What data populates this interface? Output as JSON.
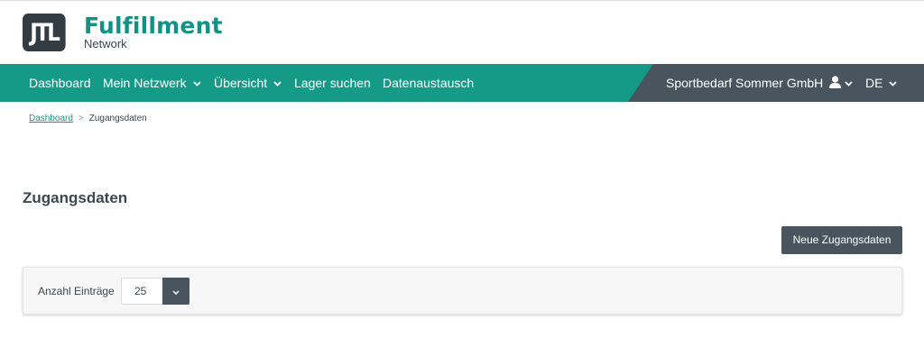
{
  "logo": {
    "mark": "JTL",
    "title": "Fulfillment",
    "subtitle": "Network"
  },
  "nav": {
    "items": [
      {
        "label": "Dashboard"
      },
      {
        "label": "Mein Netzwerk"
      },
      {
        "label": "Übersicht"
      },
      {
        "label": "Lager suchen"
      },
      {
        "label": "Datenaustausch"
      }
    ],
    "company": "Sportbedarf Sommer GmbH",
    "language": "DE"
  },
  "breadcrumb": {
    "home": "Dashboard",
    "separator": ">",
    "current": "Zugangsdaten"
  },
  "page": {
    "title": "Zugangsdaten",
    "new_button": "Neue Zugangsdaten"
  },
  "entries": {
    "label": "Anzahl Einträge",
    "value": "25"
  },
  "colors": {
    "brand_green": "#149a87",
    "nav_dark": "#48555f",
    "logo_dark": "#343c43"
  }
}
